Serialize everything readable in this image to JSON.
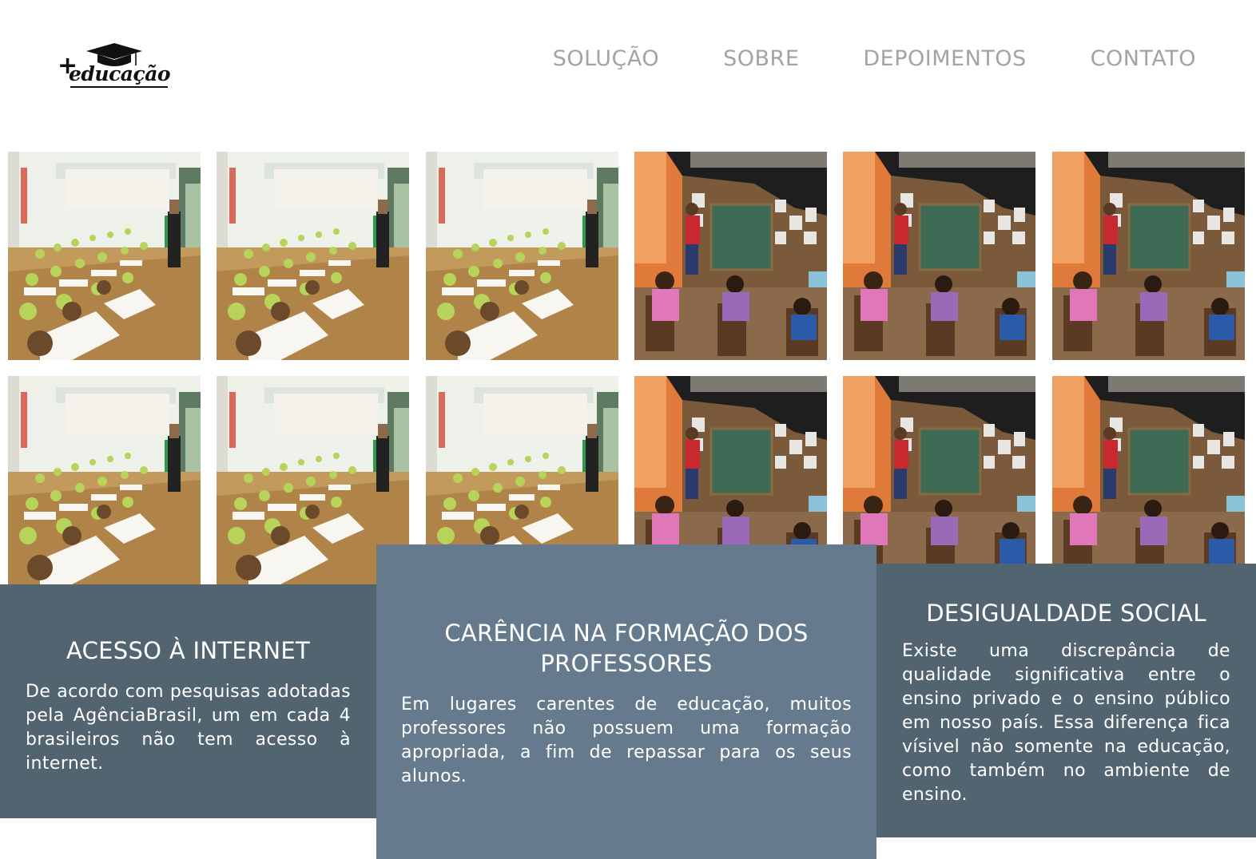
{
  "brand": {
    "logo_text": "educação",
    "logo_plus": "+"
  },
  "nav": {
    "items": [
      {
        "label": "SOLUÇÃO"
      },
      {
        "label": "SOBRE"
      },
      {
        "label": "DEPOIMENTOS"
      },
      {
        "label": "CONTATO"
      }
    ]
  },
  "gallery": {
    "rows": [
      [
        "classroom-modern",
        "classroom-modern",
        "classroom-modern",
        "classroom-rural",
        "classroom-rural",
        "classroom-rural"
      ],
      [
        "classroom-modern",
        "classroom-modern",
        "classroom-modern",
        "classroom-rural",
        "classroom-rural",
        "classroom-rural"
      ]
    ]
  },
  "cards": [
    {
      "title": "ACESSO À INTERNET",
      "text": "De acordo com pesquisas adotadas pela AgênciaBrasil, um em cada 4 brasileiros não tem acesso à internet."
    },
    {
      "title": "CARÊNCIA NA FORMAÇÃO DOS PROFESSORES",
      "text": "Em lugares carentes de educação, muitos professores não possuem uma formação apropriada, a fim de repassar para os seus alunos."
    },
    {
      "title": "DESIGUALDADE SOCIAL",
      "text": "Existe uma discrepância de qualidade significativa entre o ensino privado e o ensino público em nosso país. Essa diferença fica vísivel não somente na educação, como também no ambiente de ensino."
    }
  ],
  "colors": {
    "card_dark": "#526470",
    "card_light": "#657b8d",
    "nav_text": "#a3a3a3"
  }
}
